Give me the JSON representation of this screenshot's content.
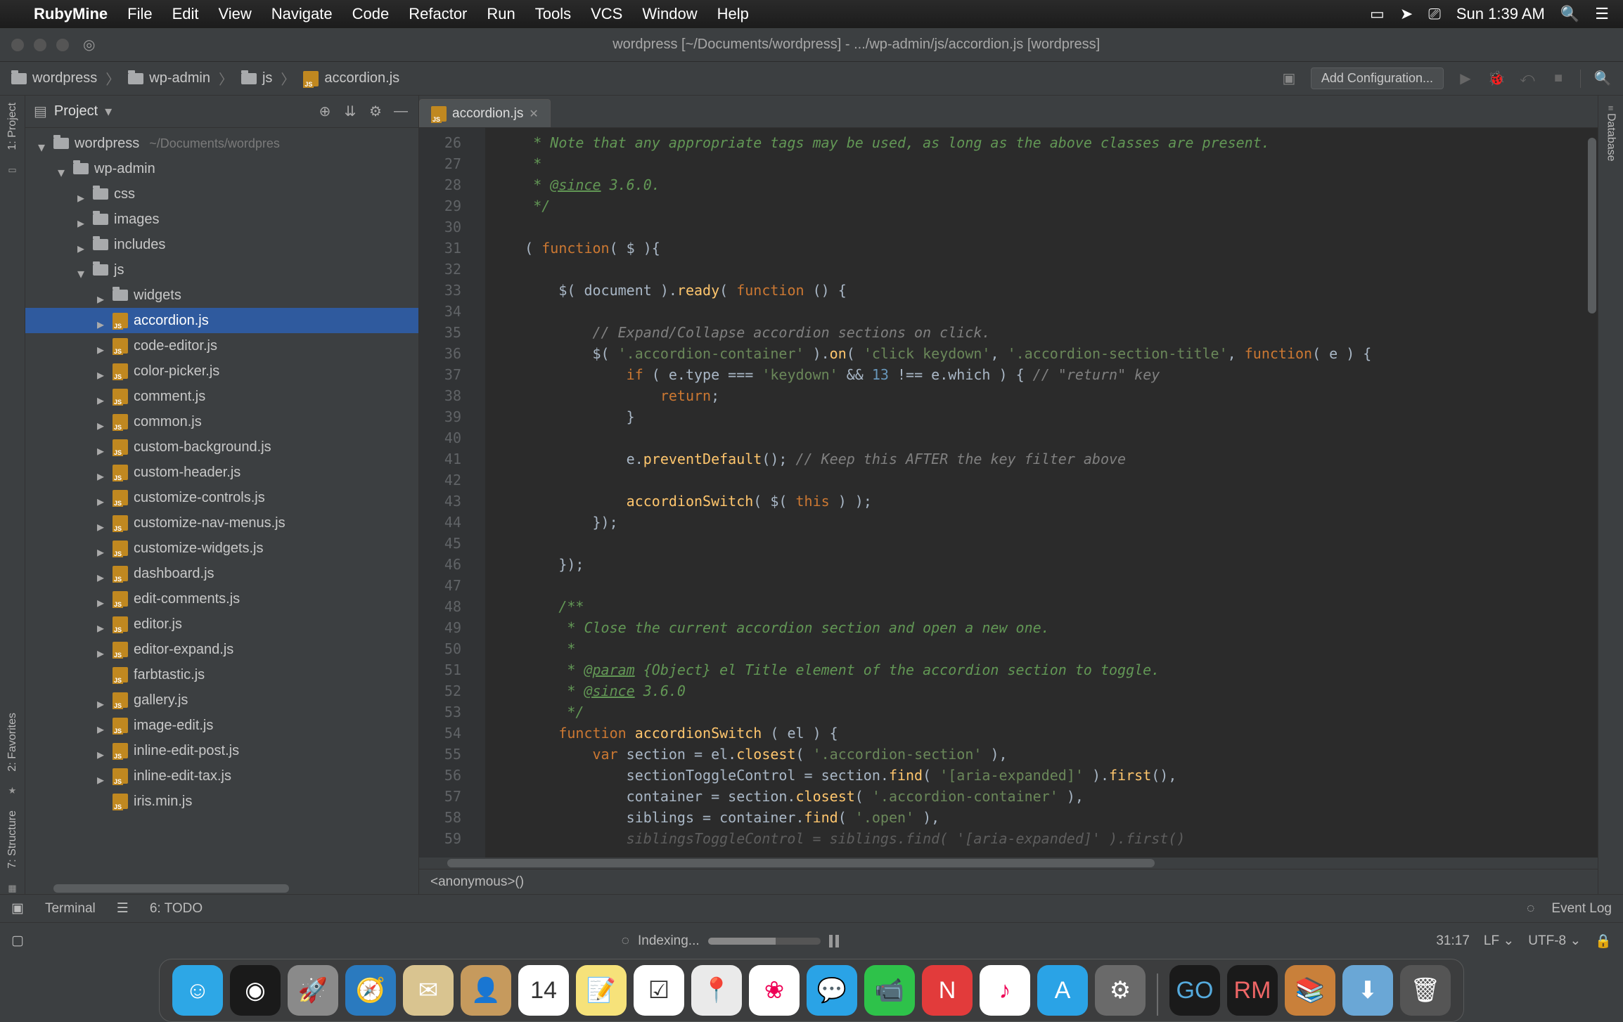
{
  "mac_menu": {
    "appname": "RubyMine",
    "items": [
      "File",
      "Edit",
      "View",
      "Navigate",
      "Code",
      "Refactor",
      "Run",
      "Tools",
      "VCS",
      "Window",
      "Help"
    ],
    "clock": "Sun 1:39 AM"
  },
  "window": {
    "title": "wordpress [~/Documents/wordpress] - .../wp-admin/js/accordion.js [wordpress]"
  },
  "breadcrumbs": [
    {
      "icon": "folder",
      "label": "wordpress"
    },
    {
      "icon": "folder",
      "label": "wp-admin"
    },
    {
      "icon": "folder",
      "label": "js"
    },
    {
      "icon": "js",
      "label": "accordion.js"
    }
  ],
  "toolbar": {
    "add_config": "Add Configuration..."
  },
  "left_strip": {
    "project": "1: Project",
    "favorites": "2: Favorites",
    "structure": "7: Structure"
  },
  "project_panel": {
    "title": "Project",
    "tree": [
      {
        "depth": 0,
        "tw": "open",
        "icon": "folder",
        "label": "wordpress",
        "suffix": "~/Documents/wordpres"
      },
      {
        "depth": 1,
        "tw": "open",
        "icon": "folder",
        "label": "wp-admin"
      },
      {
        "depth": 2,
        "tw": "closed",
        "icon": "folder",
        "label": "css"
      },
      {
        "depth": 2,
        "tw": "closed",
        "icon": "folder",
        "label": "images"
      },
      {
        "depth": 2,
        "tw": "closed",
        "icon": "folder",
        "label": "includes"
      },
      {
        "depth": 2,
        "tw": "open",
        "icon": "folder",
        "label": "js"
      },
      {
        "depth": 3,
        "tw": "closed",
        "icon": "folder",
        "label": "widgets"
      },
      {
        "depth": 3,
        "tw": "closed",
        "icon": "js",
        "label": "accordion.js",
        "selected": true
      },
      {
        "depth": 3,
        "tw": "closed",
        "icon": "js",
        "label": "code-editor.js"
      },
      {
        "depth": 3,
        "tw": "closed",
        "icon": "js",
        "label": "color-picker.js"
      },
      {
        "depth": 3,
        "tw": "closed",
        "icon": "js",
        "label": "comment.js"
      },
      {
        "depth": 3,
        "tw": "closed",
        "icon": "js",
        "label": "common.js"
      },
      {
        "depth": 3,
        "tw": "closed",
        "icon": "js",
        "label": "custom-background.js"
      },
      {
        "depth": 3,
        "tw": "closed",
        "icon": "js",
        "label": "custom-header.js"
      },
      {
        "depth": 3,
        "tw": "closed",
        "icon": "js",
        "label": "customize-controls.js"
      },
      {
        "depth": 3,
        "tw": "closed",
        "icon": "js",
        "label": "customize-nav-menus.js"
      },
      {
        "depth": 3,
        "tw": "closed",
        "icon": "js",
        "label": "customize-widgets.js"
      },
      {
        "depth": 3,
        "tw": "closed",
        "icon": "js",
        "label": "dashboard.js"
      },
      {
        "depth": 3,
        "tw": "closed",
        "icon": "js",
        "label": "edit-comments.js"
      },
      {
        "depth": 3,
        "tw": "closed",
        "icon": "js",
        "label": "editor.js"
      },
      {
        "depth": 3,
        "tw": "closed",
        "icon": "js",
        "label": "editor-expand.js"
      },
      {
        "depth": 3,
        "tw": "",
        "icon": "js",
        "label": "farbtastic.js"
      },
      {
        "depth": 3,
        "tw": "closed",
        "icon": "js",
        "label": "gallery.js"
      },
      {
        "depth": 3,
        "tw": "closed",
        "icon": "js",
        "label": "image-edit.js"
      },
      {
        "depth": 3,
        "tw": "closed",
        "icon": "js",
        "label": "inline-edit-post.js"
      },
      {
        "depth": 3,
        "tw": "closed",
        "icon": "js",
        "label": "inline-edit-tax.js"
      },
      {
        "depth": 3,
        "tw": "",
        "icon": "js",
        "label": "iris.min.js"
      }
    ]
  },
  "tabs": [
    {
      "icon": "js",
      "label": "accordion.js"
    }
  ],
  "editor": {
    "first_line_no": 26,
    "last_line_no": 59,
    "breadcrumb": "<anonymous>()"
  },
  "code_lines": [
    {
      "html": "     <span class='c-doc'>* Note that any appropriate tags may be used, as long as the above classes are present.</span>"
    },
    {
      "html": "     <span class='c-doc'>*</span>"
    },
    {
      "html": "     <span class='c-doc'>* <span class='c-doctag'>@since</span> 3.6.0.</span>"
    },
    {
      "html": "     <span class='c-doc'>*/</span>"
    },
    {
      "html": ""
    },
    {
      "html": "    ( <span class='c-kw'>function</span>( $ ){"
    },
    {
      "html": ""
    },
    {
      "html": "        $( document ).<span class='c-fn'>ready</span>( <span class='c-kw'>function</span> () {"
    },
    {
      "html": ""
    },
    {
      "html": "            <span class='c-comment'>// Expand/Collapse accordion sections on click.</span>"
    },
    {
      "html": "            $( <span class='c-str'>'.accordion-container'</span> ).<span class='c-fn'>on</span>( <span class='c-str'>'click keydown'</span>, <span class='c-str'>'.accordion-section-title'</span>, <span class='c-kw'>function</span>( e ) {"
    },
    {
      "html": "                <span class='c-kw'>if</span> ( e.type === <span class='c-str'>'keydown'</span> &amp;&amp; <span class='c-num'>13</span> !== e.which ) { <span class='c-comment'>// \"return\" key</span>"
    },
    {
      "html": "                    <span class='c-kw'>return</span>;"
    },
    {
      "html": "                }"
    },
    {
      "html": ""
    },
    {
      "html": "                e.<span class='c-fn'>preventDefault</span>(); <span class='c-comment'>// Keep this AFTER the key filter above</span>"
    },
    {
      "html": ""
    },
    {
      "html": "                <span class='c-fn'>accordionSwitch</span>( $( <span class='c-kw'>this</span> ) );"
    },
    {
      "html": "            });"
    },
    {
      "html": ""
    },
    {
      "html": "        });"
    },
    {
      "html": ""
    },
    {
      "html": "        <span class='c-doc'>/**</span>"
    },
    {
      "html": "        <span class='c-doc'> * Close the current accordion section and open a new one.</span>"
    },
    {
      "html": "        <span class='c-doc'> *</span>"
    },
    {
      "html": "        <span class='c-doc'> * <span class='c-doctag'>@param</span> {Object} el Title element of the accordion section to toggle.</span>"
    },
    {
      "html": "        <span class='c-doc'> * <span class='c-doctag'>@since</span> 3.6.0</span>"
    },
    {
      "html": "        <span class='c-doc'> */</span>"
    },
    {
      "html": "        <span class='c-kw'>function</span> <span class='c-fn'>accordionSwitch</span> ( el ) {"
    },
    {
      "html": "            <span class='c-kw'>var</span> section = el.<span class='c-fn'>closest</span>( <span class='c-str'>'.accordion-section'</span> ),"
    },
    {
      "html": "                sectionToggleControl = section.<span class='c-fn'>find</span>( <span class='c-str'>'[aria-expanded]'</span> ).<span class='c-fn'>first</span>(),"
    },
    {
      "html": "                container = section.<span class='c-fn'>closest</span>( <span class='c-str'>'.accordion-container'</span> ),"
    },
    {
      "html": "                siblings = container.<span class='c-fn'>find</span>( <span class='c-str'>'.open'</span> ),"
    },
    {
      "html": "                <span class='c-comment' style='opacity:.6'>siblingsToggleControl = siblings.find( '[aria-expanded]' ).first()</span>"
    }
  ],
  "bottom": {
    "terminal": "Terminal",
    "todo": "6: TODO",
    "event_log": "Event Log"
  },
  "status": {
    "indexing": "Indexing...",
    "position": "31:17",
    "line_sep": "LF",
    "encoding": "UTF-8"
  },
  "right_strip": {
    "database": "Database"
  },
  "dock": {
    "apps": [
      {
        "name": "finder",
        "bg": "#2da7e6",
        "glyph": "☺"
      },
      {
        "name": "siri",
        "bg": "#1a1a1a",
        "glyph": "◉"
      },
      {
        "name": "launchpad",
        "bg": "#8a8a8a",
        "glyph": "🚀"
      },
      {
        "name": "safari",
        "bg": "#2a7abf",
        "glyph": "🧭"
      },
      {
        "name": "mail",
        "bg": "#d9c490",
        "glyph": "✉"
      },
      {
        "name": "contacts",
        "bg": "#c69a5d",
        "glyph": "👤"
      },
      {
        "name": "calendar",
        "bg": "#fff",
        "glyph": "14",
        "text": "#333"
      },
      {
        "name": "notes",
        "bg": "#f6e27a",
        "glyph": "📝"
      },
      {
        "name": "reminders",
        "bg": "#fff",
        "glyph": "☑",
        "text": "#333"
      },
      {
        "name": "maps",
        "bg": "#eaeaea",
        "glyph": "📍",
        "text": "#333"
      },
      {
        "name": "photos",
        "bg": "#fff",
        "glyph": "❀",
        "text": "#e05"
      },
      {
        "name": "messages",
        "bg": "#2aa3e6",
        "glyph": "💬"
      },
      {
        "name": "facetime",
        "bg": "#2ec24a",
        "glyph": "📹"
      },
      {
        "name": "news",
        "bg": "#e23b3b",
        "glyph": "N"
      },
      {
        "name": "itunes",
        "bg": "#fff",
        "glyph": "♪",
        "text": "#e05"
      },
      {
        "name": "appstore",
        "bg": "#2aa3e6",
        "glyph": "A"
      },
      {
        "name": "preferences",
        "bg": "#6a6a6a",
        "glyph": "⚙"
      }
    ],
    "apps_right": [
      {
        "name": "goland",
        "bg": "#1a1a1a",
        "glyph": "GO",
        "text": "#5ad"
      },
      {
        "name": "rubymine",
        "bg": "#1a1a1a",
        "glyph": "RM",
        "text": "#e66"
      },
      {
        "name": "books",
        "bg": "#c9803a",
        "glyph": "📚"
      },
      {
        "name": "downloads",
        "bg": "#6aa7d6",
        "glyph": "⬇"
      },
      {
        "name": "trash",
        "bg": "#555",
        "glyph": "🗑"
      }
    ]
  }
}
